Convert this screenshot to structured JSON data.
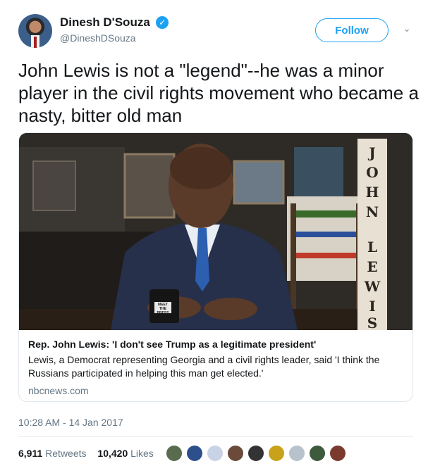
{
  "author": {
    "display_name": "Dinesh D'Souza",
    "handle": "@DineshDSouza",
    "verified_icon": "verified-badge-icon"
  },
  "follow_label": "Follow",
  "tweet_text": "John Lewis is not a \"legend\"--he was a minor player in the civil rights movement who became a nasty, bitter old man",
  "card": {
    "title": "Rep. John Lewis: 'I don't see Trump as a legitimate president'",
    "description": "Lewis, a Democrat representing Georgia and a civil rights leader, said 'I think the Russians participated in helping this man get elected.'",
    "domain": "nbcnews.com",
    "sign_letters": [
      "J",
      "O",
      "H",
      "N",
      "L",
      "E",
      "W",
      "I",
      "S"
    ],
    "mug_text": "MEET THE PRESS"
  },
  "timestamp": "10:28 AM - 14 Jan 2017",
  "stats": {
    "retweets_count": "6,911",
    "retweets_label": "Retweets",
    "likes_count": "10,420",
    "likes_label": "Likes"
  },
  "liker_colors": [
    "#5a6b4e",
    "#2d4f8b",
    "#c9d3e6",
    "#6b4a3a",
    "#333333",
    "#c8a21a",
    "#b8c2cc",
    "#3e5a3c",
    "#7a3b2e"
  ],
  "colors": {
    "accent": "#1da1f2",
    "text": "#14171a",
    "secondary": "#657786"
  }
}
